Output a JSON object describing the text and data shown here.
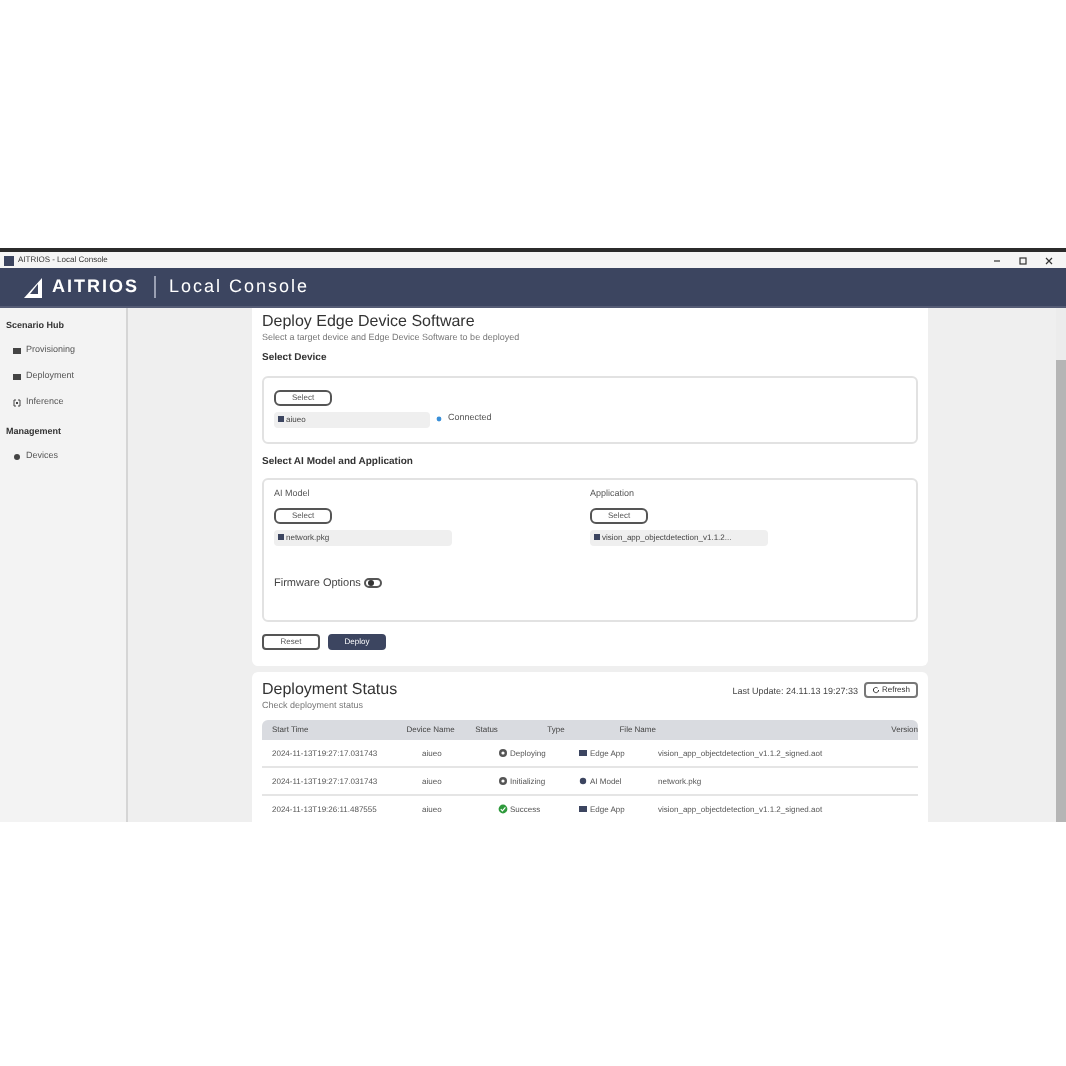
{
  "window": {
    "title": "AITRIOS - Local Console"
  },
  "header": {
    "brand": "AITRIOS",
    "product": "Local Console"
  },
  "sidebar": {
    "sections": [
      {
        "heading": "Scenario Hub",
        "items": [
          {
            "label": "Provisioning",
            "selected": false
          },
          {
            "label": "Deployment",
            "selected": false
          },
          {
            "label": "Inference",
            "selected": false
          }
        ]
      },
      {
        "heading": "Management",
        "items": [
          {
            "label": "Devices",
            "selected": false
          }
        ]
      }
    ]
  },
  "deploy": {
    "title": "Deploy Edge Device Software",
    "subtitle": "Select a target device and Edge Device Software to be deployed",
    "device_section": {
      "heading": "Select Device",
      "button": "Select",
      "device": "aiueo",
      "status": "Connected",
      "connected": true
    },
    "model_section": {
      "heading": "Select AI Model and Application",
      "columns": [
        {
          "label": "AI Model",
          "button": "Select",
          "value": "network.pkg"
        },
        {
          "label": "Application",
          "button": "Select",
          "value": "vision_app_objectdetection_v1.1.2..."
        }
      ],
      "firmware": {
        "label": "Firmware Options",
        "on": false
      }
    },
    "buttons": [
      {
        "label": "Reset",
        "kind": "secondary"
      },
      {
        "label": "Deploy",
        "kind": "primary"
      }
    ]
  },
  "status": {
    "title": "Deployment Status",
    "subtitle": "Check deployment status",
    "last_update": "Last Update: 24.11.13 19:27:33",
    "refresh": "Refresh",
    "table": {
      "columns": [
        "Start Time",
        "Device Name",
        "Status",
        "Type",
        "File Name",
        "Version"
      ],
      "rows": [
        {
          "start_time": "2024-11-13T19:27:17.031743",
          "device": "aiueo",
          "status": {
            "label": "Deploying",
            "kind": "progress"
          },
          "type": {
            "label": "Edge App",
            "kind": "app"
          },
          "file": "vision_app_objectdetection_v1.1.2_signed.aot"
        },
        {
          "start_time": "2024-11-13T19:27:17.031743",
          "device": "aiueo",
          "status": {
            "label": "Initializing",
            "kind": "progress"
          },
          "type": {
            "label": "AI Model",
            "kind": "model"
          },
          "file": "network.pkg"
        },
        {
          "start_time": "2024-11-13T19:26:11.487555",
          "device": "aiueo",
          "status": {
            "label": "Success",
            "kind": "success"
          },
          "type": {
            "label": "Edge App",
            "kind": "app"
          },
          "file": "vision_app_objectdetection_v1.1.2_signed.aot"
        }
      ]
    }
  }
}
